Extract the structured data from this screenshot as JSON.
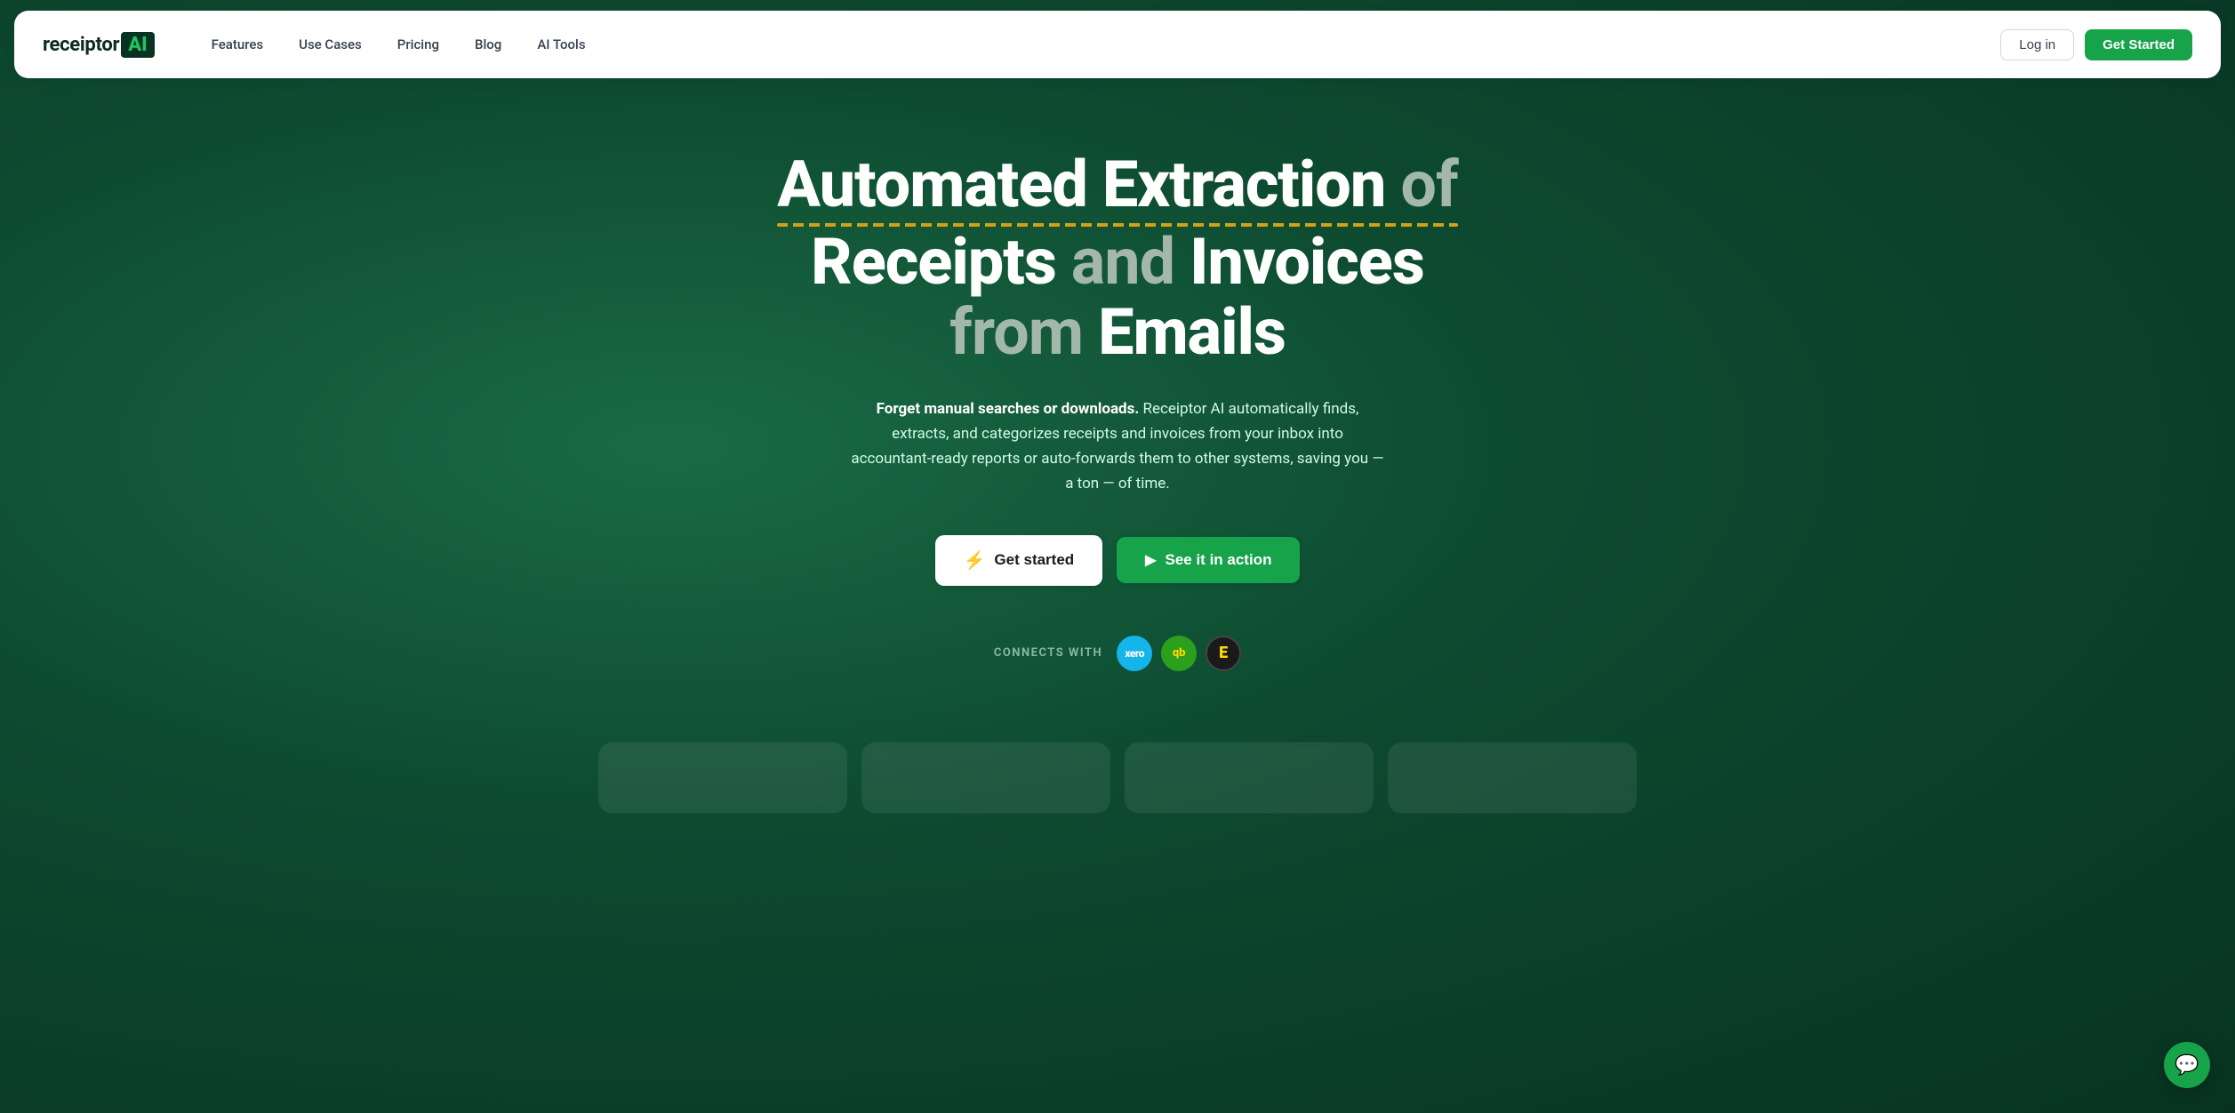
{
  "brand": {
    "name_part1": "receiptor",
    "name_bracket": "AI",
    "logo_alt": "Receiptor AI logo"
  },
  "nav": {
    "links": [
      {
        "label": "Features",
        "id": "features"
      },
      {
        "label": "Use Cases",
        "id": "use-cases"
      },
      {
        "label": "Pricing",
        "id": "pricing"
      },
      {
        "label": "Blog",
        "id": "blog"
      },
      {
        "label": "AI Tools",
        "id": "ai-tools"
      }
    ],
    "login_label": "Log in",
    "get_started_label": "Get Started"
  },
  "hero": {
    "title_line1": "Automated Extraction",
    "title_word_of": "of",
    "title_line2": "Receipts",
    "title_word_and": "and",
    "title_line3": "Invoices",
    "title_word_from": "from",
    "title_line4": "Emails",
    "subtitle_bold": "Forget manual searches or downloads.",
    "subtitle_rest": " Receiptor AI automatically finds, extracts, and categorizes receipts and invoices from your inbox into accountant-ready reports or auto-forwards them to other systems, saving you — a ton — of time.",
    "btn_get_started": "Get started",
    "btn_lightning_icon": "⚡",
    "btn_see_action": "See it in action",
    "btn_play_icon": "▶"
  },
  "connects": {
    "label": "CONNECTS WITH",
    "integrations": [
      {
        "name": "xero",
        "display": "xero",
        "bg": "#13b5ea"
      },
      {
        "name": "quickbooks",
        "display": "qb",
        "bg": "#2ca01c"
      },
      {
        "name": "expensify",
        "display": "E",
        "bg": "#1a1a1a"
      }
    ]
  },
  "chat": {
    "icon": "💬"
  }
}
